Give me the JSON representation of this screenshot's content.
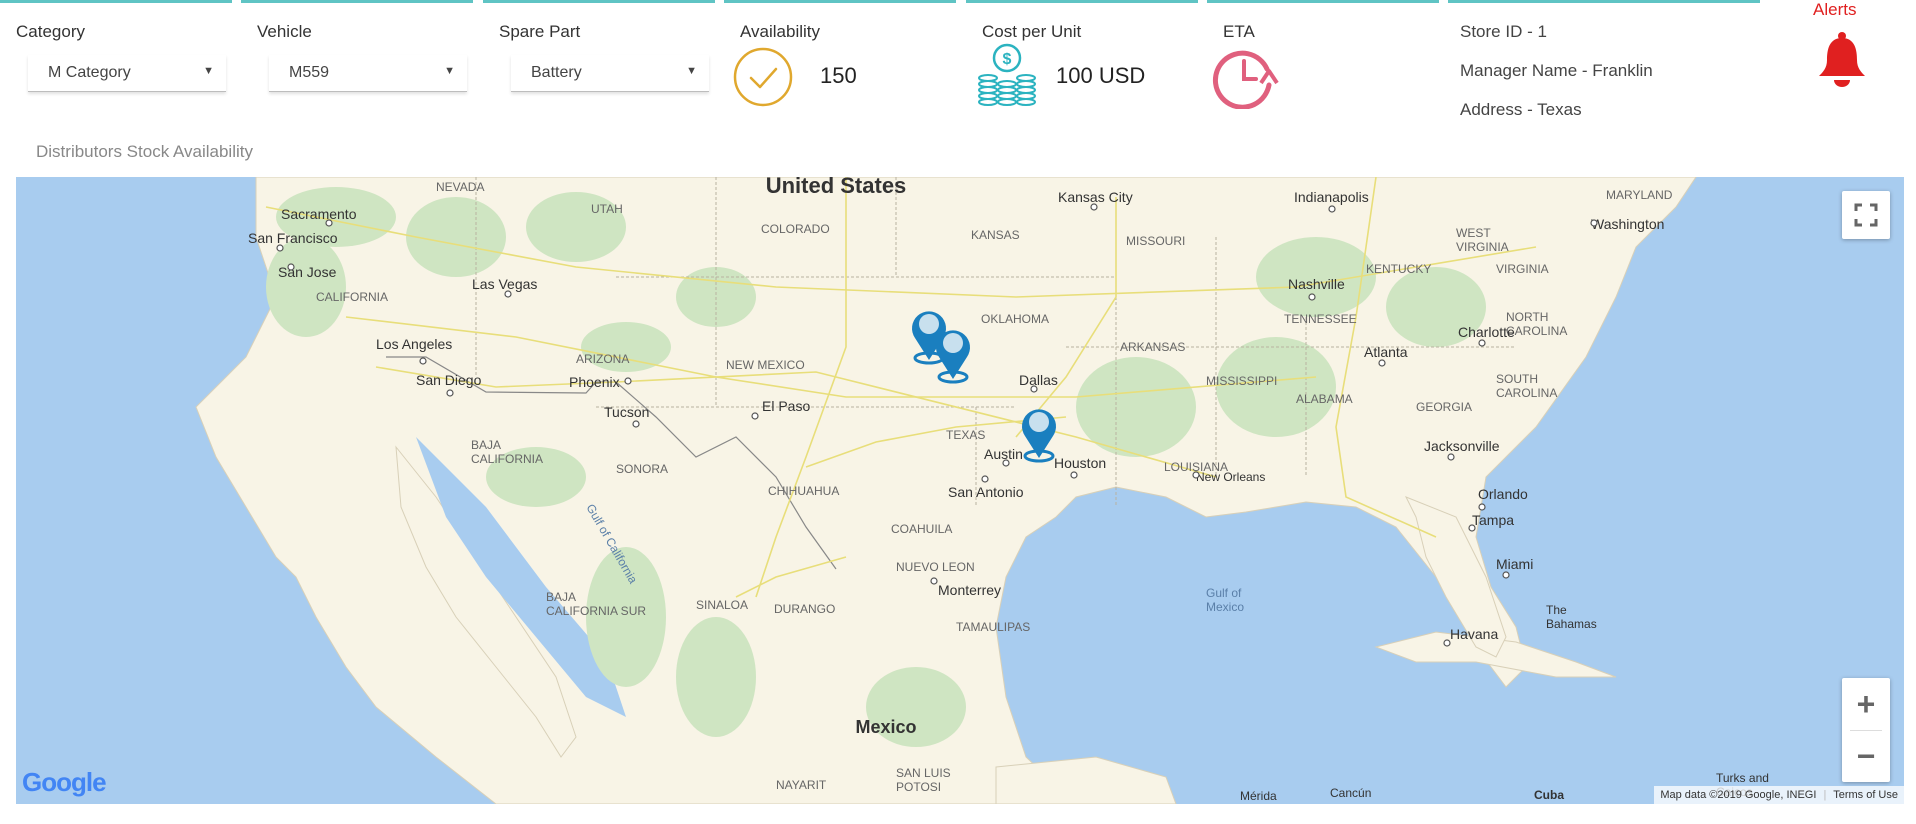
{
  "filters": {
    "category": {
      "title": "Category",
      "value": "M Category"
    },
    "vehicle": {
      "title": "Vehicle",
      "value": "M559"
    },
    "spare_part": {
      "title": "Spare Part",
      "value": "Battery"
    }
  },
  "kpis": {
    "availability": {
      "title": "Availability",
      "value": "150"
    },
    "cost": {
      "title": "Cost per Unit",
      "value": "100 USD"
    },
    "eta": {
      "title": "ETA"
    }
  },
  "store": {
    "id": "Store ID - 1",
    "manager": "Manager Name - Franklin",
    "address": "Address - Texas"
  },
  "alerts": {
    "label": "Alerts"
  },
  "map": {
    "section_title": "Distributors Stock Availability",
    "attribution": "Map data ©2019 Google, INEGI",
    "terms": "Terms of Use",
    "logo_text": "Google",
    "zoom_in": "+",
    "zoom_out": "−",
    "labels": {
      "us": "United States",
      "mexico": "Mexico",
      "nevada": "NEVADA",
      "utah": "UTAH",
      "colorado": "COLORADO",
      "kansas": "KANSAS",
      "missouri": "MISSOURI",
      "kentucky": "KENTUCKY",
      "west_virginia": "WEST\nVIRGINIA",
      "virginia": "VIRGINIA",
      "maryland": "MARYLAND",
      "oklahoma": "OKLAHOMA",
      "arkansas": "ARKANSAS",
      "tennessee": "TENNESSEE",
      "north_carolina": "NORTH\nCAROLINA",
      "south_carolina": "SOUTH\nCAROLINA",
      "mississippi": "MISSISSIPPI",
      "alabama": "ALABAMA",
      "georgia": "GEORGIA",
      "louisiana": "LOUISIANA",
      "texas": "TEXAS",
      "new_mexico": "NEW MEXICO",
      "arizona": "ARIZONA",
      "california": "CALIFORNIA",
      "sonora": "SONORA",
      "chihuahua": "CHIHUAHUA",
      "coahuila": "COAHUILA",
      "nuevo_leon": "NUEVO LEON",
      "tamaulipas": "TAMAULIPAS",
      "durango": "DURANGO",
      "sinaloa": "SINALOA",
      "baja_california": "BAJA\nCALIFORNIA",
      "baja_california_sur": "BAJA\nCALIFORNIA SUR",
      "nayarit": "NAYARIT",
      "san_luis_potosi": "SAN LUIS\nPOTOSI",
      "gulf_of_mexico": "Gulf of\nMexico",
      "gulf_of_california": "Gulf of California",
      "the_bahamas": "The\nBahamas",
      "turks_and_caicos": "Turks and\nCaicos",
      "cuba": "Cuba",
      "havana": "Havana",
      "sacramento": "Sacramento",
      "san_francisco": "San Francisco",
      "san_jose": "San Jose",
      "las_vegas": "Las Vegas",
      "los_angeles": "Los Angeles",
      "san_diego": "San Diego",
      "phoenix": "Phoenix",
      "tucson": "Tucson",
      "el_paso": "El Paso",
      "dallas": "Dallas",
      "austin": "Austin",
      "houston": "Houston",
      "san_antonio": "San Antonio",
      "kansas_city": "Kansas City",
      "indianapolis": "Indianapolis",
      "washington": "Washington",
      "nashville": "Nashville",
      "charlotte": "Charlotte",
      "atlanta": "Atlanta",
      "jacksonville": "Jacksonville",
      "orlando": "Orlando",
      "tampa": "Tampa",
      "miami": "Miami",
      "new_orleans": "New Orleans",
      "monterrey": "Monterrey",
      "merida": "Mérida",
      "cancun": "Cancún"
    }
  },
  "colors": {
    "accent": "#5fc4c4",
    "alert_red": "#e02020",
    "availability_icon": "#e0a82e",
    "cost_icon": "#2bb3c0",
    "eta_icon": "#e0607e",
    "marker_blue": "#1a7fbf",
    "water": "#a8ccef",
    "land": "#f8f4e6"
  },
  "icons": [
    "check-circle-icon",
    "coin-stack-icon",
    "clock-refresh-icon",
    "bell-icon",
    "fullscreen-icon",
    "map-marker-icon"
  ]
}
